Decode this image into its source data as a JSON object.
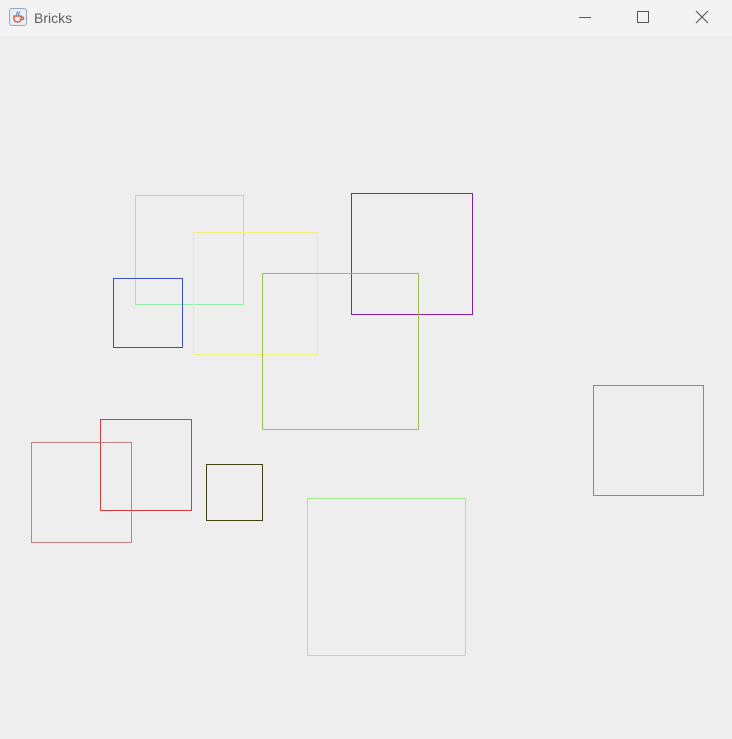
{
  "window": {
    "title": "Bricks",
    "app_icon": "java-cup-icon"
  },
  "controls": {
    "minimize": "minimize-icon",
    "maximize": "maximize-icon",
    "close": "close-icon"
  },
  "bricks": [
    {
      "name": "brick-mint",
      "color": "#8ff0a8"
    },
    {
      "name": "brick-yellow",
      "color": "#f0f07a"
    },
    {
      "name": "brick-purple",
      "color": "#8a1ea8"
    },
    {
      "name": "brick-blue",
      "color": "#3a4ec8"
    },
    {
      "name": "brick-olive-green",
      "color": "#9cc050"
    },
    {
      "name": "brick-cyan",
      "color": "#20b4d0"
    },
    {
      "name": "brick-red",
      "color": "#d03a3a"
    },
    {
      "name": "brick-rose",
      "color": "#c08080"
    },
    {
      "name": "brick-dark-olive",
      "color": "#404010"
    },
    {
      "name": "brick-light-green",
      "color": "#a8e890"
    }
  ]
}
